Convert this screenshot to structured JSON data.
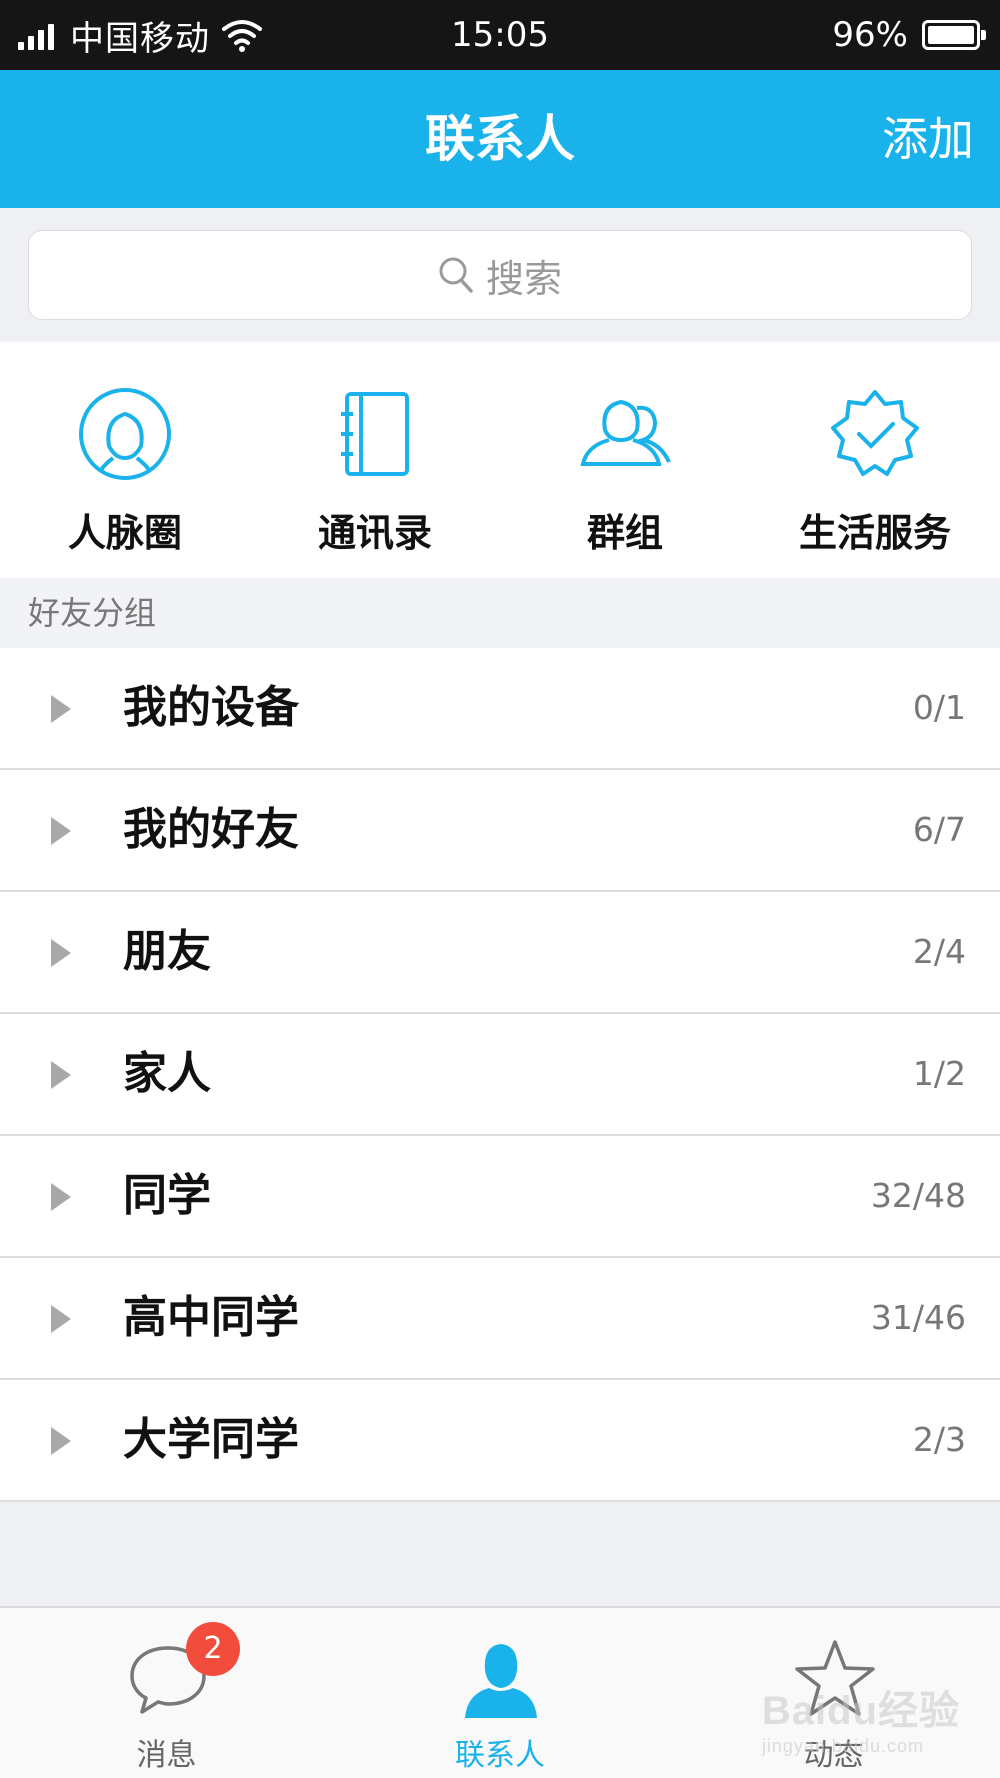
{
  "status_bar": {
    "carrier": "中国移动",
    "time": "15:05",
    "battery": "96%"
  },
  "header": {
    "title": "联系人",
    "add_label": "添加"
  },
  "search": {
    "placeholder": "搜索"
  },
  "quick_entries": [
    {
      "label": "人脉圈",
      "icon": "person-circle-icon"
    },
    {
      "label": "通讯录",
      "icon": "address-book-icon"
    },
    {
      "label": "群组",
      "icon": "group-icon"
    },
    {
      "label": "生活服务",
      "icon": "service-badge-icon"
    }
  ],
  "section": {
    "title": "好友分组"
  },
  "groups": [
    {
      "name": "我的设备",
      "count": "0/1"
    },
    {
      "name": "我的好友",
      "count": "6/7"
    },
    {
      "name": "朋友",
      "count": "2/4"
    },
    {
      "name": "家人",
      "count": "1/2"
    },
    {
      "name": "同学",
      "count": "32/48"
    },
    {
      "name": "高中同学",
      "count": "31/46"
    },
    {
      "name": "大学同学",
      "count": "2/3"
    }
  ],
  "tabs": [
    {
      "label": "消息",
      "icon": "chat-bubble-icon",
      "badge": "2",
      "active": false
    },
    {
      "label": "联系人",
      "icon": "contact-person-icon",
      "active": true
    },
    {
      "label": "动态",
      "icon": "star-icon",
      "active": false
    }
  ],
  "watermark": {
    "text": "Baidu经验",
    "sub": "jingyan.baidu.com"
  },
  "colors": {
    "accent": "#1ab2ea",
    "status_bar": "#151515",
    "badge": "#f24c3d"
  }
}
